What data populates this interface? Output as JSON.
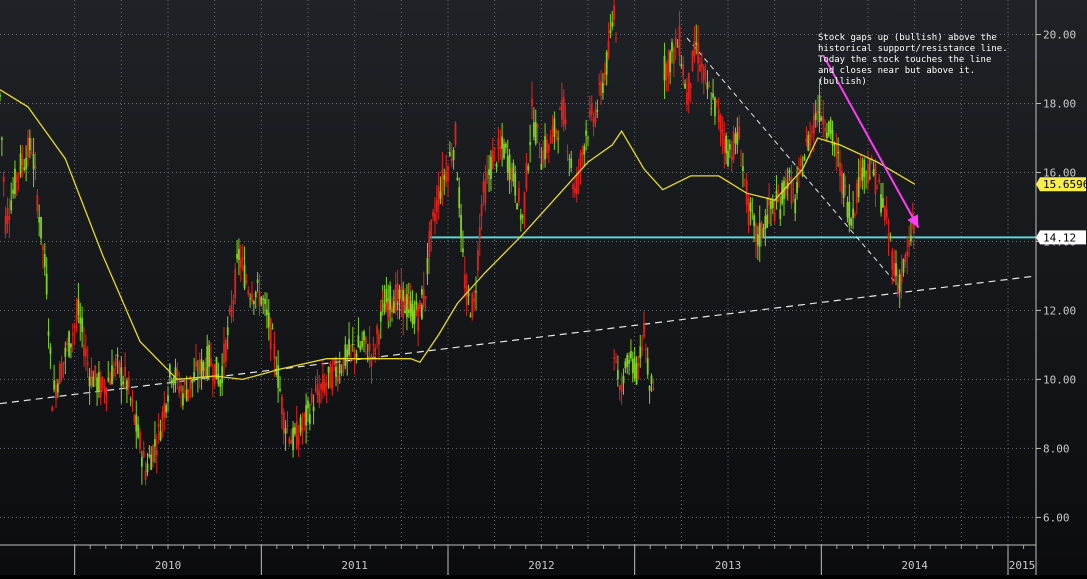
{
  "chart_data": {
    "type": "candlestick",
    "title": "",
    "xlabel": "",
    "ylabel": "",
    "xlim": [
      2009.6,
      2015.15
    ],
    "ylim": [
      5.2,
      21.0
    ],
    "grid": true,
    "y_ticks": [
      "6.00",
      "8.00",
      "10.00",
      "12.00",
      "14.00",
      "16.00",
      "18.00",
      "20.00"
    ],
    "x_ticks": [
      "2010",
      "2011",
      "2012",
      "2013",
      "2014",
      "2015"
    ],
    "last_price": "14.12",
    "moving_average_last": "15.6596",
    "support_resistance_level": 14.12,
    "annotation_lines": [
      "Stock gaps up (bullish) above the",
      "historical support/resistance line.",
      "Today the stock touches the line",
      "and closes near but above it.",
      "(bullish)"
    ],
    "price_path": [
      {
        "x": 2009.6,
        "y": 18.2
      },
      {
        "x": 2009.63,
        "y": 14.6
      },
      {
        "x": 2009.7,
        "y": 16.1
      },
      {
        "x": 2009.77,
        "y": 16.8
      },
      {
        "x": 2009.82,
        "y": 14.3
      },
      {
        "x": 2009.85,
        "y": 12.8
      },
      {
        "x": 2009.88,
        "y": 9.5
      },
      {
        "x": 2009.95,
        "y": 10.7
      },
      {
        "x": 2010.02,
        "y": 11.9
      },
      {
        "x": 2010.08,
        "y": 10.2
      },
      {
        "x": 2010.15,
        "y": 9.7
      },
      {
        "x": 2010.22,
        "y": 10.4
      },
      {
        "x": 2010.28,
        "y": 9.9
      },
      {
        "x": 2010.33,
        "y": 8.6
      },
      {
        "x": 2010.38,
        "y": 7.4
      },
      {
        "x": 2010.45,
        "y": 8.4
      },
      {
        "x": 2010.52,
        "y": 10.3
      },
      {
        "x": 2010.58,
        "y": 9.6
      },
      {
        "x": 2010.65,
        "y": 10.1
      },
      {
        "x": 2010.72,
        "y": 10.6
      },
      {
        "x": 2010.78,
        "y": 10.0
      },
      {
        "x": 2010.83,
        "y": 11.6
      },
      {
        "x": 2010.88,
        "y": 13.6
      },
      {
        "x": 2010.93,
        "y": 12.7
      },
      {
        "x": 2011.0,
        "y": 12.4
      },
      {
        "x": 2011.04,
        "y": 11.6
      },
      {
        "x": 2011.08,
        "y": 10.5
      },
      {
        "x": 2011.12,
        "y": 8.9
      },
      {
        "x": 2011.17,
        "y": 8.2
      },
      {
        "x": 2011.22,
        "y": 8.6
      },
      {
        "x": 2011.28,
        "y": 9.4
      },
      {
        "x": 2011.35,
        "y": 9.9
      },
      {
        "x": 2011.42,
        "y": 10.4
      },
      {
        "x": 2011.48,
        "y": 10.8
      },
      {
        "x": 2011.55,
        "y": 11.0
      },
      {
        "x": 2011.6,
        "y": 10.7
      },
      {
        "x": 2011.66,
        "y": 12.2
      },
      {
        "x": 2011.72,
        "y": 12.4
      },
      {
        "x": 2011.78,
        "y": 12.1
      },
      {
        "x": 2011.85,
        "y": 11.8
      },
      {
        "x": 2011.88,
        "y": 12.6
      },
      {
        "x": 2011.9,
        "y": 13.9
      },
      {
        "x": 2011.95,
        "y": 15.4
      },
      {
        "x": 2012.0,
        "y": 16.2
      },
      {
        "x": 2012.04,
        "y": 17.0
      },
      {
        "x": 2012.08,
        "y": 13.5
      },
      {
        "x": 2012.1,
        "y": 12.3
      },
      {
        "x": 2012.14,
        "y": 12.1
      },
      {
        "x": 2012.18,
        "y": 15.1
      },
      {
        "x": 2012.24,
        "y": 16.4
      },
      {
        "x": 2012.3,
        "y": 16.7
      },
      {
        "x": 2012.35,
        "y": 15.9
      },
      {
        "x": 2012.4,
        "y": 14.6
      },
      {
        "x": 2012.45,
        "y": 17.7
      },
      {
        "x": 2012.5,
        "y": 16.5
      },
      {
        "x": 2012.55,
        "y": 16.9
      },
      {
        "x": 2012.62,
        "y": 17.8
      },
      {
        "x": 2012.68,
        "y": 15.4
      },
      {
        "x": 2012.74,
        "y": 17.2
      },
      {
        "x": 2012.8,
        "y": 17.9
      },
      {
        "x": 2012.86,
        "y": 19.4
      },
      {
        "x": 2012.89,
        "y": 20.8
      },
      {
        "x": 2012.91,
        "y": 19.6
      }
    ],
    "price_path_2": [
      {
        "x": 2013.16,
        "y": 19.0
      },
      {
        "x": 2013.21,
        "y": 19.5
      },
      {
        "x": 2013.24,
        "y": 19.8
      },
      {
        "x": 2013.28,
        "y": 18.2
      },
      {
        "x": 2013.33,
        "y": 19.7
      },
      {
        "x": 2013.38,
        "y": 18.5
      },
      {
        "x": 2013.44,
        "y": 17.8
      },
      {
        "x": 2013.5,
        "y": 16.6
      },
      {
        "x": 2013.56,
        "y": 17.0
      },
      {
        "x": 2013.61,
        "y": 14.9
      },
      {
        "x": 2013.66,
        "y": 14.0
      },
      {
        "x": 2013.72,
        "y": 14.9
      },
      {
        "x": 2013.78,
        "y": 15.1
      },
      {
        "x": 2013.82,
        "y": 15.9
      },
      {
        "x": 2013.86,
        "y": 15.1
      },
      {
        "x": 2013.9,
        "y": 16.3
      },
      {
        "x": 2013.94,
        "y": 17.1
      },
      {
        "x": 2013.98,
        "y": 17.9
      },
      {
        "x": 2014.02,
        "y": 17.6
      },
      {
        "x": 2014.07,
        "y": 16.8
      },
      {
        "x": 2014.11,
        "y": 15.8
      },
      {
        "x": 2014.16,
        "y": 14.7
      },
      {
        "x": 2014.22,
        "y": 16.2
      },
      {
        "x": 2014.28,
        "y": 16.0
      },
      {
        "x": 2014.33,
        "y": 15.1
      },
      {
        "x": 2014.37,
        "y": 13.9
      },
      {
        "x": 2014.41,
        "y": 12.8
      },
      {
        "x": 2014.44,
        "y": 13.2
      },
      {
        "x": 2014.47,
        "y": 13.7
      },
      {
        "x": 2014.49,
        "y": 14.6
      },
      {
        "x": 2014.5,
        "y": 14.12
      }
    ],
    "price_path_detached_2012": [
      {
        "x": 2011.64,
        "y": 12.2
      },
      {
        "x": 2011.7,
        "y": 12.0
      },
      {
        "x": 2011.76,
        "y": 12.4
      },
      {
        "x": 2011.82,
        "y": 11.9
      },
      {
        "x": 2011.87,
        "y": 12.5
      }
    ],
    "price_path_detached_2013": [
      {
        "x": 2012.89,
        "y": 10.5
      },
      {
        "x": 2012.93,
        "y": 9.9
      },
      {
        "x": 2012.97,
        "y": 10.6
      },
      {
        "x": 2013.01,
        "y": 10.2
      },
      {
        "x": 2013.05,
        "y": 11.3
      },
      {
        "x": 2013.08,
        "y": 9.8
      },
      {
        "x": 2013.11,
        "y": 9.7
      }
    ],
    "moving_average": [
      {
        "x": 2009.6,
        "y": 18.4
      },
      {
        "x": 2009.75,
        "y": 17.9
      },
      {
        "x": 2009.95,
        "y": 16.4
      },
      {
        "x": 2010.15,
        "y": 13.6
      },
      {
        "x": 2010.35,
        "y": 11.1
      },
      {
        "x": 2010.55,
        "y": 10.0
      },
      {
        "x": 2010.75,
        "y": 10.1
      },
      {
        "x": 2010.9,
        "y": 10.0
      },
      {
        "x": 2011.1,
        "y": 10.3
      },
      {
        "x": 2011.35,
        "y": 10.6
      },
      {
        "x": 2011.6,
        "y": 10.6
      },
      {
        "x": 2011.8,
        "y": 10.6
      },
      {
        "x": 2011.85,
        "y": 10.5
      },
      {
        "x": 2011.95,
        "y": 11.3
      },
      {
        "x": 2012.05,
        "y": 12.2
      },
      {
        "x": 2012.2,
        "y": 13.1
      },
      {
        "x": 2012.4,
        "y": 14.2
      },
      {
        "x": 2012.6,
        "y": 15.4
      },
      {
        "x": 2012.75,
        "y": 16.3
      },
      {
        "x": 2012.88,
        "y": 16.8
      },
      {
        "x": 2012.93,
        "y": 17.2
      },
      {
        "x": 2013.05,
        "y": 16.1
      },
      {
        "x": 2013.15,
        "y": 15.5
      },
      {
        "x": 2013.3,
        "y": 15.9
      },
      {
        "x": 2013.45,
        "y": 15.9
      },
      {
        "x": 2013.6,
        "y": 15.4
      },
      {
        "x": 2013.75,
        "y": 15.2
      },
      {
        "x": 2013.9,
        "y": 16.1
      },
      {
        "x": 2013.98,
        "y": 17.0
      },
      {
        "x": 2014.1,
        "y": 16.8
      },
      {
        "x": 2014.3,
        "y": 16.3
      },
      {
        "x": 2014.5,
        "y": 15.66
      }
    ],
    "trendline_support": [
      {
        "x": 2009.6,
        "y": 9.3
      },
      {
        "x": 2015.15,
        "y": 13.0
      }
    ],
    "trendline_downtrend": [
      {
        "x": 2013.28,
        "y": 19.9
      },
      {
        "x": 2014.43,
        "y": 12.6
      }
    ],
    "arrow": {
      "from": {
        "x": 2014.01,
        "y": 19.4
      },
      "to": {
        "x": 2014.52,
        "y": 14.4
      }
    },
    "colors": {
      "up": "#7ed321",
      "down": "#e3201b",
      "moving_average": "#e8d82c",
      "support_line": "#5fd3d1",
      "trendline": "#e6e6e6",
      "arrow": "#ff3cf5",
      "ma_badge": "#f7ee4a",
      "price_badge": "#ffffff",
      "grid": "#6b6f75"
    }
  }
}
